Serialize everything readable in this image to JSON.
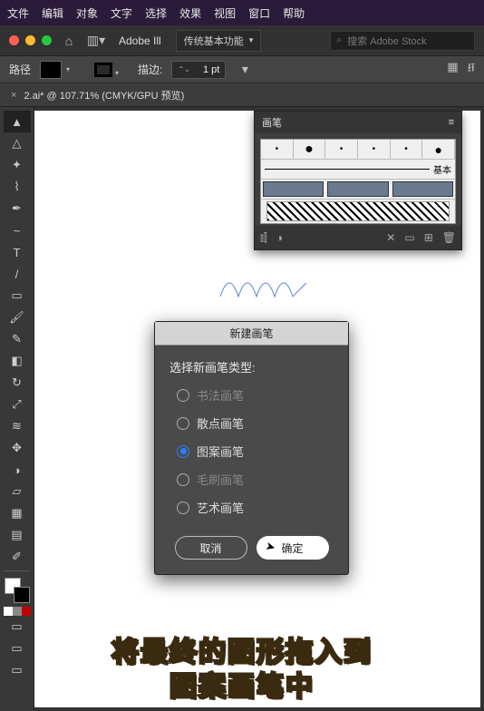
{
  "menubar": {
    "items": [
      "文件",
      "编辑",
      "对象",
      "文字",
      "选择",
      "效果",
      "视图",
      "窗口",
      "帮助"
    ]
  },
  "appbar": {
    "brand": "Adobe Ill",
    "workspace": "传统基本功能",
    "search_placeholder": "搜索 Adobe Stock"
  },
  "controlbar": {
    "mode": "路径",
    "stroke_label": "描边:",
    "stroke_value": "1 pt"
  },
  "tab": {
    "title": "2.ai* @ 107.71% (CMYK/GPU 预览)"
  },
  "tools": [
    {
      "name": "selection",
      "glyph": "▲"
    },
    {
      "name": "direct-selection",
      "glyph": "△"
    },
    {
      "name": "magic-wand",
      "glyph": "✦"
    },
    {
      "name": "lasso",
      "glyph": "⌇"
    },
    {
      "name": "pen",
      "glyph": "✒"
    },
    {
      "name": "curvature",
      "glyph": "~"
    },
    {
      "name": "type",
      "glyph": "T"
    },
    {
      "name": "line",
      "glyph": "/"
    },
    {
      "name": "rectangle",
      "glyph": "▭"
    },
    {
      "name": "paintbrush",
      "glyph": "🖌"
    },
    {
      "name": "pencil",
      "glyph": "✎"
    },
    {
      "name": "eraser",
      "glyph": "◧"
    },
    {
      "name": "rotate",
      "glyph": "↻"
    },
    {
      "name": "scale",
      "glyph": "⤢"
    },
    {
      "name": "width",
      "glyph": "≋"
    },
    {
      "name": "free-transform",
      "glyph": "✥"
    },
    {
      "name": "shape-builder",
      "glyph": "◑"
    },
    {
      "name": "perspective",
      "glyph": "▱"
    },
    {
      "name": "mesh",
      "glyph": "▦"
    },
    {
      "name": "gradient",
      "glyph": "▤"
    },
    {
      "name": "eyedropper",
      "glyph": "✐"
    }
  ],
  "brushpanel": {
    "title": "画笔",
    "basic_label": "基本"
  },
  "dialog": {
    "title": "新建画笔",
    "prompt": "选择新画笔类型:",
    "options": [
      {
        "key": "calligraphic",
        "label": "书法画笔",
        "enabled": false,
        "checked": false
      },
      {
        "key": "scatter",
        "label": "散点画笔",
        "enabled": true,
        "checked": false
      },
      {
        "key": "pattern",
        "label": "图案画笔",
        "enabled": true,
        "checked": true
      },
      {
        "key": "bristle",
        "label": "毛刷画笔",
        "enabled": false,
        "checked": false
      },
      {
        "key": "art",
        "label": "艺术画笔",
        "enabled": true,
        "checked": false
      }
    ],
    "cancel": "取消",
    "ok": "确定"
  },
  "caption": {
    "line1": "将最终的图形拖入到",
    "line2": "图案画笔中"
  }
}
